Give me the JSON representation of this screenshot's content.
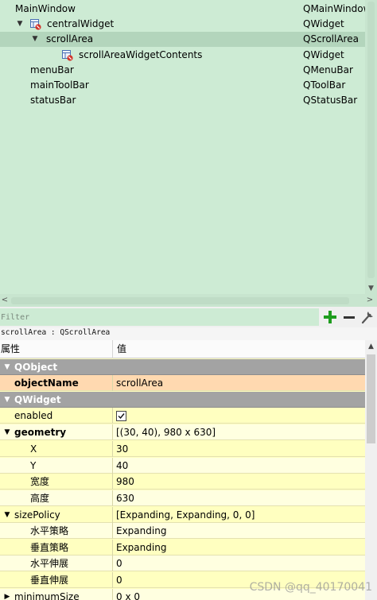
{
  "object_inspector": {
    "rows": [
      {
        "name": "MainWindow",
        "class": "QMainWindow"
      },
      {
        "name": "centralWidget",
        "class": "QWidget"
      },
      {
        "name": "scrollArea",
        "class": "QScrollArea"
      },
      {
        "name": "scrollAreaWidgetContents",
        "class": "QWidget"
      },
      {
        "name": "menuBar",
        "class": "QMenuBar"
      },
      {
        "name": "mainToolBar",
        "class": "QToolBar"
      },
      {
        "name": "statusBar",
        "class": "QStatusBar"
      }
    ],
    "selected_row": "scrollArea"
  },
  "filter": {
    "placeholder": "Filter",
    "add_icon": "plus-icon",
    "remove_icon": "minus-icon",
    "config_icon": "wrench-icon",
    "add_color": "#1f9d1f",
    "remove_color": "#333333"
  },
  "object_label": "scrollArea : QScrollArea",
  "property_editor": {
    "header": {
      "property": "属性",
      "value": "值"
    },
    "groups": [
      {
        "label": "QObject"
      },
      {
        "label": "QWidget"
      }
    ],
    "rows": {
      "objectName": {
        "name": "objectName",
        "value": "scrollArea"
      },
      "enabled": {
        "name": "enabled",
        "checked": true
      },
      "geometry": {
        "name": "geometry",
        "value": "[(30, 40), 980 x 630]"
      },
      "x": {
        "name": "X",
        "value": "30"
      },
      "y": {
        "name": "Y",
        "value": "40"
      },
      "width": {
        "name": "宽度",
        "value": "980"
      },
      "height": {
        "name": "高度",
        "value": "630"
      },
      "sizePolicy": {
        "name": "sizePolicy",
        "value": "[Expanding, Expanding, 0, 0]"
      },
      "hPolicy": {
        "name": "水平策略",
        "value": "Expanding"
      },
      "vPolicy": {
        "name": "垂直策略",
        "value": "Expanding"
      },
      "hStretch": {
        "name": "水平伸展",
        "value": "0"
      },
      "vStretch": {
        "name": "垂直伸展",
        "value": "0"
      },
      "minimumSize": {
        "name": "minimumSize",
        "value": "0 x 0"
      }
    },
    "colors": {
      "group": "#a3a3a3",
      "selected": "#ffd9b0",
      "row": "#ffffc0",
      "row_alt": "#ffffe0"
    }
  },
  "watermark": "CSDN @qq_40170041"
}
